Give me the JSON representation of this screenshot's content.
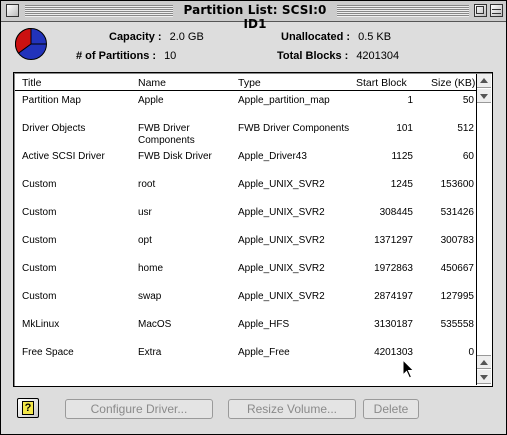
{
  "window": {
    "title": "Partition List: SCSI:0  ID1"
  },
  "info": {
    "capacity_label": "Capacity :",
    "capacity_value": "2.0 GB",
    "partitions_label": "# of Partitions :",
    "partitions_value": "10",
    "unallocated_label": "Unallocated :",
    "unallocated_value": "0.5 KB",
    "total_blocks_label": "Total Blocks :",
    "total_blocks_value": "4201304"
  },
  "pie_colors": {
    "primary": "#cc1111",
    "secondary": "#2233bb"
  },
  "table": {
    "columns": [
      "Title",
      "Name",
      "Type",
      "Start Block",
      "Size (KB)"
    ],
    "rows": [
      {
        "title": "Partition Map",
        "name": "Apple",
        "type": "Apple_partition_map",
        "start": "1",
        "size": "50"
      },
      {
        "title": "Driver Objects",
        "name": "FWB Driver Components",
        "type": "FWB Driver Components",
        "start": "101",
        "size": "512"
      },
      {
        "title": "Active SCSI Driver",
        "name": "FWB Disk Driver",
        "type": "Apple_Driver43",
        "start": "1125",
        "size": "60"
      },
      {
        "title": "Custom",
        "name": "root",
        "type": "Apple_UNIX_SVR2",
        "start": "1245",
        "size": "153600"
      },
      {
        "title": "Custom",
        "name": "usr",
        "type": "Apple_UNIX_SVR2",
        "start": "308445",
        "size": "531426"
      },
      {
        "title": "Custom",
        "name": "opt",
        "type": "Apple_UNIX_SVR2",
        "start": "1371297",
        "size": "300783"
      },
      {
        "title": "Custom",
        "name": "home",
        "type": "Apple_UNIX_SVR2",
        "start": "1972863",
        "size": "450667"
      },
      {
        "title": "Custom",
        "name": "swap",
        "type": "Apple_UNIX_SVR2",
        "start": "2874197",
        "size": "127995"
      },
      {
        "title": "MkLinux",
        "name": "MacOS",
        "type": "Apple_HFS",
        "start": "3130187",
        "size": "535558"
      },
      {
        "title": "Free Space",
        "name": "Extra",
        "type": "Apple_Free",
        "start": "4201303",
        "size": "0"
      }
    ]
  },
  "buttons": {
    "help": "?",
    "configure": "Configure Driver...",
    "resize": "Resize Volume...",
    "delete": "Delete"
  }
}
